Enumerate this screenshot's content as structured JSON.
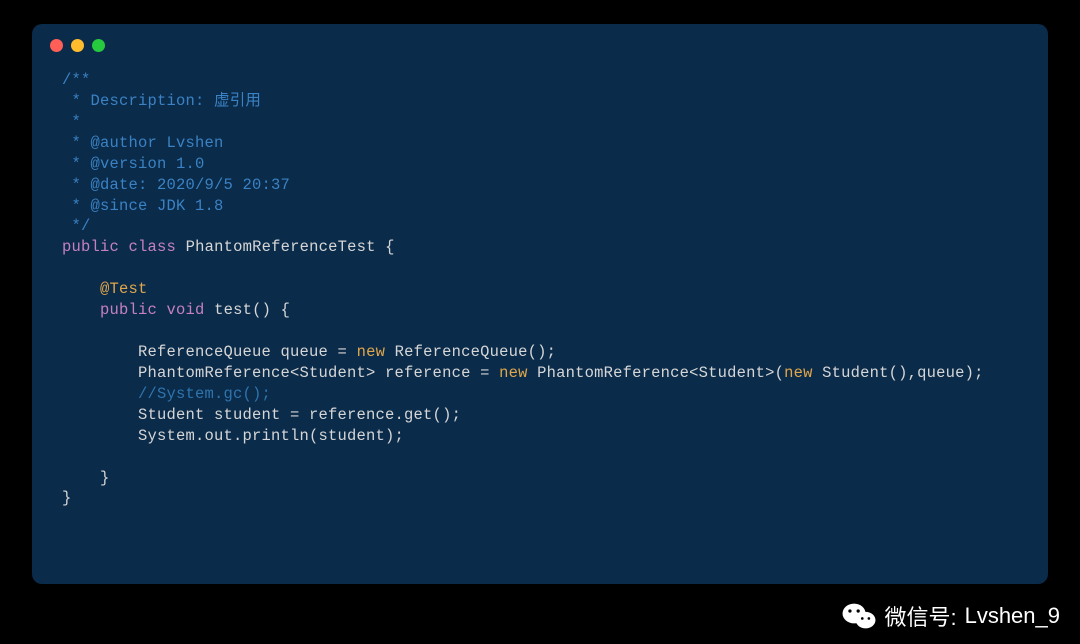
{
  "code": {
    "c1": "/**",
    "c2": " * Description: 虚引用",
    "c3": " *",
    "c4": " * @author Lvshen",
    "c5": " * @version 1.0",
    "c6": " * @date: 2020/9/5 20:37",
    "c7": " * @since JDK 1.8",
    "c8": " */",
    "kw_public": "public",
    "kw_class": "class",
    "class_name": "PhantomReferenceTest",
    "brace_open": " {",
    "blank": "",
    "indent1": "    ",
    "indent2": "        ",
    "anno_test": "@Test",
    "kw_void": "void",
    "method_name": "test",
    "paren_brace": "() {",
    "l1_a": "ReferenceQueue queue = ",
    "kw_new": "new",
    "l1_b": " ReferenceQueue();",
    "l2_a": "PhantomReference<Student> reference = ",
    "l2_b": " PhantomReference<Student>(",
    "l2_c": " Student(),queue);",
    "l3": "//System.gc();",
    "l4": "Student student = reference.get();",
    "l5": "System.out.println(student);",
    "brace_close1": "}",
    "brace_close2": "}"
  },
  "watermark": {
    "label": "微信号:",
    "handle": "Lvshen_9"
  }
}
